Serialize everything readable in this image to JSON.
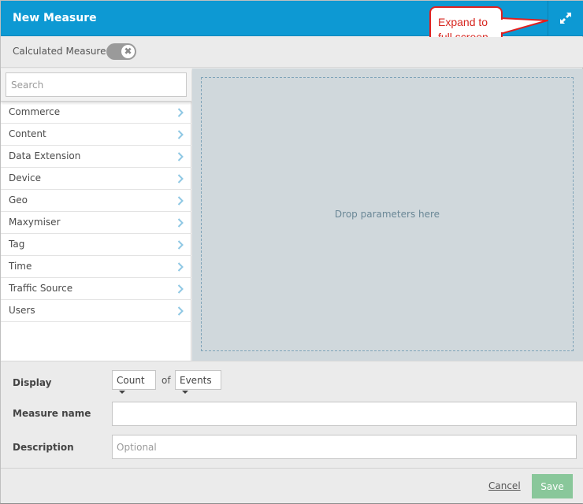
{
  "dialog": {
    "title": "New Measure"
  },
  "callout": {
    "line1": "Expand to",
    "line2": "full screen",
    "color": "#e0201f"
  },
  "calculated": {
    "label": "Calculated Measure",
    "toggle_state": "off",
    "toggle_glyph": "✖"
  },
  "search": {
    "placeholder": "Search",
    "value": ""
  },
  "categories": [
    {
      "label": "Commerce"
    },
    {
      "label": "Content"
    },
    {
      "label": "Data Extension"
    },
    {
      "label": "Device"
    },
    {
      "label": "Geo"
    },
    {
      "label": "Maxymiser"
    },
    {
      "label": "Tag"
    },
    {
      "label": "Time"
    },
    {
      "label": "Traffic Source"
    },
    {
      "label": "Users"
    }
  ],
  "drop_zone": {
    "text": "Drop parameters here"
  },
  "form": {
    "display_label": "Display",
    "aggregation": "Count",
    "of_text": "of",
    "entity": "Events",
    "measure_name_label": "Measure name",
    "measure_name_value": "",
    "description_label": "Description",
    "description_placeholder": "Optional",
    "description_value": ""
  },
  "footer": {
    "cancel_label": "Cancel",
    "save_label": "Save"
  },
  "colors": {
    "header": "#0d99d3",
    "save": "#89c79a",
    "drop_area": "#d0d8dc",
    "chevron": "#8fc8e4"
  }
}
